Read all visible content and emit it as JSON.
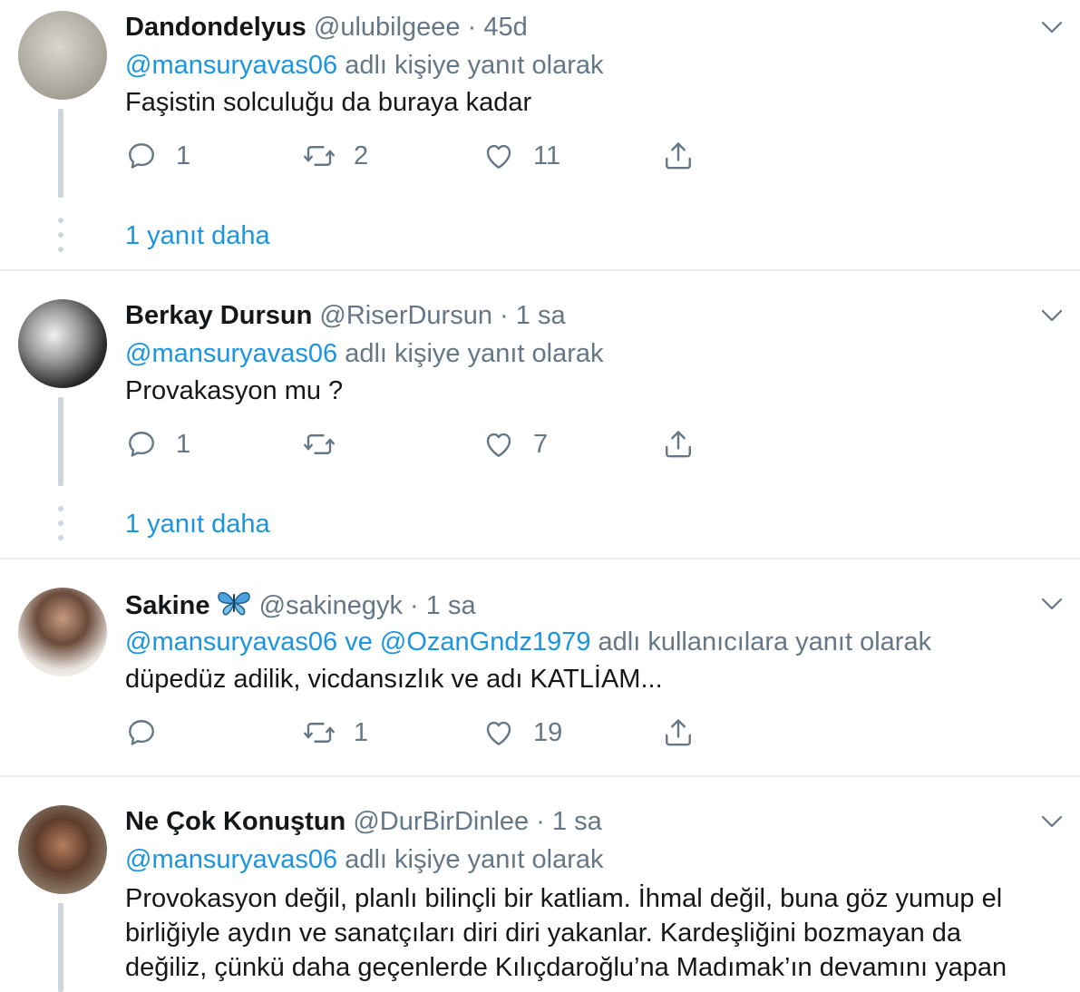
{
  "tweets": [
    {
      "name": "Dandondelyus",
      "handle": "@ulubilgeee",
      "sep": "·",
      "time": "45d",
      "mention": "@mansuryavas06",
      "reply_suffix": "adlı kişiye yanıt olarak",
      "text": "Faşistin solculuğu da buraya kadar",
      "replies": "1",
      "retweets": "2",
      "likes": "11",
      "more": "1 yanıt daha"
    },
    {
      "name": "Berkay Dursun",
      "handle": "@RiserDursun",
      "sep": "·",
      "time": "1 sa",
      "mention": "@mansuryavas06",
      "reply_suffix": "adlı kişiye yanıt olarak",
      "text": "Provakasyon mu ?",
      "replies": "1",
      "retweets": "",
      "likes": "7",
      "more": "1 yanıt daha"
    },
    {
      "name": "Sakine",
      "handle": "@sakinegyk",
      "sep": "·",
      "time": "1 sa",
      "mention": "@mansuryavas06 ve @OzanGndz1979",
      "reply_suffix": "adlı kullanıcılara yanıt olarak",
      "text": "düpedüz adilik, vicdansızlık ve adı KATLİAM...",
      "replies": "",
      "retweets": "1",
      "likes": "19"
    },
    {
      "name": "Ne Çok Konuştun",
      "handle": "@DurBirDinlee",
      "sep": "·",
      "time": "1 sa",
      "mention": "@mansuryavas06",
      "reply_suffix": "adlı kişiye yanıt olarak",
      "text_lines": [
        "Provokasyon değil, planlı bilinçli bir katliam. İhmal değil, buna göz yumup el",
        "birliğiyle aydın ve sanatçıları diri diri yakanlar. Kardeşliğini bozmayan da",
        "değiliz, çünkü daha geçenlerde Kılıçdaroğlu’na Madımak’ın devamını yapan"
      ]
    }
  ],
  "icons": {
    "reply": "reply-icon",
    "retweet": "retweet-icon",
    "like": "heart-icon",
    "share": "share-icon",
    "caret": "chevron-down-icon",
    "emoji": "butterfly-icon"
  },
  "colors": {
    "link": "#1b95e0",
    "muted": "#657786",
    "text": "#14171a",
    "divider": "#e6ecf0",
    "thread": "#ccd6dd"
  }
}
